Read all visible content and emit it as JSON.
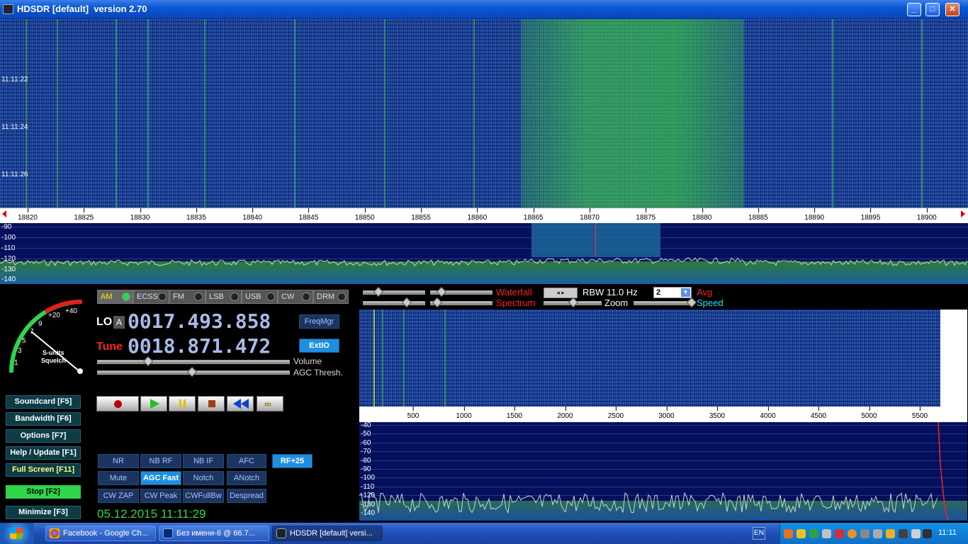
{
  "window": {
    "title": "HDSDR [default]  version 2.70"
  },
  "waterfall": {
    "timestamps": [
      "11:11:22",
      "11:11:24",
      "11:11:26"
    ]
  },
  "freq_scale": {
    "ticks": [
      "18820",
      "18825",
      "18830",
      "18835",
      "18840",
      "18845",
      "18850",
      "18855",
      "18860",
      "18865",
      "18870",
      "18875",
      "18880",
      "18885",
      "18890",
      "18895",
      "18900"
    ]
  },
  "spectrum": {
    "db_labels": [
      "-90",
      "-100",
      "-110",
      "-120",
      "-130",
      "-140"
    ]
  },
  "smeter": {
    "labels": [
      "+40",
      "+20",
      "9",
      "7",
      "5",
      "3",
      "1"
    ],
    "text1": "S-units",
    "text2": "Squelch"
  },
  "modes": [
    "AM",
    "ECSS",
    "FM",
    "LSB",
    "USB",
    "CW",
    "DRM"
  ],
  "lo": {
    "label": "LO",
    "tag": "A",
    "value": "0017.493.858"
  },
  "tune": {
    "label": "Tune",
    "value": "0018.871.472"
  },
  "buttons": {
    "freqmgr": "FreqMgr",
    "extio": "ExtIO"
  },
  "sliders": {
    "volume": "Volume",
    "agc": "AGC Thresh."
  },
  "side_buttons": [
    {
      "label": "Soundcard  [F5]"
    },
    {
      "label": "Bandwidth  [F6]"
    },
    {
      "label": "Options  [F7]"
    },
    {
      "label": "Help / Update  [F1]"
    },
    {
      "label": "Full Screen  [F11]"
    },
    {
      "label": "Stop        [F2]"
    },
    {
      "label": "Minimize  [F3]"
    }
  ],
  "dsp_row1": [
    "NR",
    "NB RF",
    "NB IF",
    "AFC",
    "RF+25"
  ],
  "dsp_row2": [
    "Mute",
    "AGC Fast",
    "Notch",
    "ANotch"
  ],
  "dsp_row3": [
    "CW ZAP",
    "CW Peak",
    "CWFullBw",
    "Despread"
  ],
  "datetime": "05.12.2015 11:11:29",
  "af_controls": {
    "waterfall": "Waterfall",
    "spectrum": "Spectrum",
    "rbw": "RBW 11.0 Hz",
    "avg_value": "2",
    "avg": "Avg",
    "zoom": "Zoom",
    "speed": "Speed"
  },
  "af_scale": {
    "ticks": [
      "500",
      "1000",
      "1500",
      "2000",
      "2500",
      "3000",
      "3500",
      "4000",
      "4500",
      "5000",
      "5500"
    ]
  },
  "af_spec": {
    "db_labels": [
      "-40",
      "-50",
      "-60",
      "-70",
      "-80",
      "-90",
      "-100",
      "-110",
      "-120",
      "-130",
      "-140"
    ]
  },
  "taskbar": {
    "tasks": [
      "Facebook - Google Ch...",
      "Без имени-6 @ 66.7...",
      "HDSDR [default]  versi..."
    ],
    "lang": "EN",
    "clock": "11:11"
  },
  "colors": {
    "accent": "#1e8fe0",
    "stop_green": "#2fd64a",
    "tune_red": "#ff2020",
    "waterfall_red": "#ff2020",
    "speed_cyan": "#1ee0ff"
  }
}
